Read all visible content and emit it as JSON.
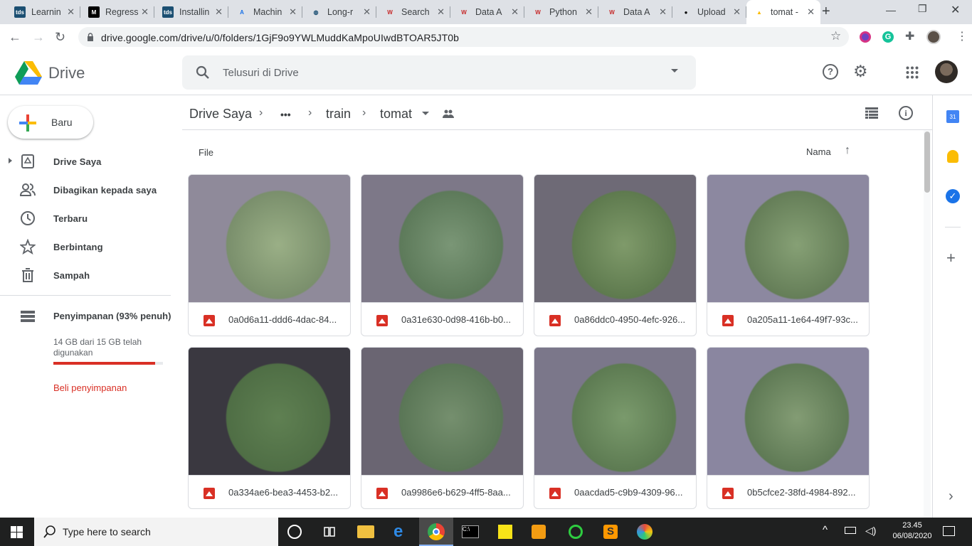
{
  "browser": {
    "tabs": [
      {
        "title": "Learnin",
        "fav_text": "tds",
        "fav_bg": "#1b4f72",
        "fav_color": "#ffffff"
      },
      {
        "title": "Regress",
        "fav_text": "M",
        "fav_bg": "#000000",
        "fav_color": "#ffffff"
      },
      {
        "title": "Installin",
        "fav_text": "tds",
        "fav_bg": "#1b4f72",
        "fav_color": "#ffffff"
      },
      {
        "title": "Machin",
        "fav_text": "A",
        "fav_bg": "#dee1e6",
        "fav_color": "#1a73e8"
      },
      {
        "title": "Long-r",
        "fav_text": "◍",
        "fav_bg": "#dee1e6",
        "fav_color": "#1b4f72"
      },
      {
        "title": "Search",
        "fav_text": "W",
        "fav_bg": "#dee1e6",
        "fav_color": "#c62828"
      },
      {
        "title": "Data A",
        "fav_text": "W",
        "fav_bg": "#dee1e6",
        "fav_color": "#c62828"
      },
      {
        "title": "Python",
        "fav_text": "W",
        "fav_bg": "#dee1e6",
        "fav_color": "#c62828"
      },
      {
        "title": "Data A",
        "fav_text": "W",
        "fav_bg": "#dee1e6",
        "fav_color": "#c62828"
      },
      {
        "title": "Upload",
        "fav_text": "●",
        "fav_bg": "#dee1e6",
        "fav_color": "#000000"
      },
      {
        "title": "tomat -",
        "fav_text": "▲",
        "fav_bg": "#ffffff",
        "fav_color": "#fbbc04",
        "active": true
      }
    ],
    "url": "drive.google.com/drive/u/0/folders/1GjF9o9YWLMuddKaMpoUIwdBTOAR5JT0b"
  },
  "drive": {
    "logo_text": "Drive",
    "search_placeholder": "Telusuri di Drive",
    "new_button": "Baru",
    "nav": [
      {
        "label": "Drive Saya",
        "icon": "my-drive-icon"
      },
      {
        "label": "Dibagikan kepada saya",
        "icon": "shared-icon"
      },
      {
        "label": "Terbaru",
        "icon": "clock-icon"
      },
      {
        "label": "Berbintang",
        "icon": "star-icon"
      },
      {
        "label": "Sampah",
        "icon": "trash-icon"
      }
    ],
    "storage": {
      "label": "Penyimpanan (93% penuh)",
      "detail": "14 GB dari 15 GB telah digunakan",
      "fraction_used": 0.93,
      "buy": "Beli penyimpanan"
    },
    "breadcrumb": {
      "root": "Drive Saya",
      "more": "•••",
      "parent": "train",
      "current": "tomat"
    },
    "section_label": "File",
    "sort_label": "Nama",
    "files": [
      {
        "name": "0a0d6a11-ddd6-4dac-84..."
      },
      {
        "name": "0a31e630-0d98-416b-b0..."
      },
      {
        "name": "0a86ddc0-4950-4efc-926..."
      },
      {
        "name": "0a205a11-1e64-49f7-93c..."
      },
      {
        "name": "0a334ae6-bea3-4453-b2..."
      },
      {
        "name": "0a9986e6-b629-4ff5-8aa..."
      },
      {
        "name": "0aacdad5-c9b9-4309-96..."
      },
      {
        "name": "0b5cfce2-38fd-4984-892..."
      }
    ]
  },
  "taskbar": {
    "search_text": "Type here to search",
    "time": "23.45",
    "date": "06/08/2020"
  },
  "colors": {
    "accent": "#1a73e8",
    "storage_warning": "#d93025"
  }
}
